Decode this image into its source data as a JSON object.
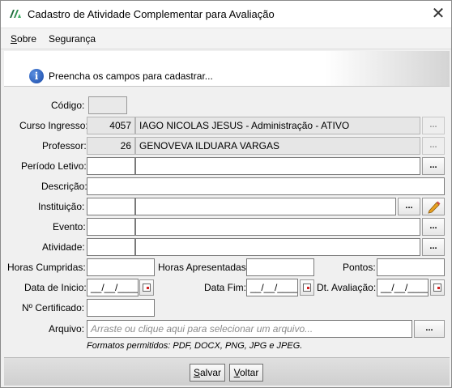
{
  "window": {
    "title": "Cadastro de Atividade Complementar para Avaliação",
    "close_glyph": "✕"
  },
  "menu": {
    "items": [
      {
        "label_first": "S",
        "label_rest": "obre"
      },
      {
        "label_first": "",
        "label_rest": "Segurança"
      }
    ]
  },
  "banner": {
    "icon": "info-icon",
    "text": "Preencha os campos para cadastrar..."
  },
  "form": {
    "codigo": {
      "label": "Código:",
      "value": ""
    },
    "curso": {
      "label": "Curso Ingresso:",
      "code": "4057",
      "description": "IAGO NICOLAS JESUS - Administração - ATIVO"
    },
    "professor": {
      "label": "Professor:",
      "code": "26",
      "description": "GENOVEVA ILDUARA VARGAS"
    },
    "periodo": {
      "label": "Período Letivo:",
      "code": "",
      "description": ""
    },
    "descricao": {
      "label": "Descrição:",
      "value": ""
    },
    "instituicao": {
      "label": "Instituição:",
      "code": "",
      "description": ""
    },
    "evento": {
      "label": "Evento:",
      "code": "",
      "description": ""
    },
    "atividade": {
      "label": "Atividade:",
      "code": "",
      "description": ""
    },
    "horas_cumpridas": {
      "label": "Horas Cumpridas:",
      "value": ""
    },
    "horas_apresentadas": {
      "label": "Horas Apresentadas:",
      "value": ""
    },
    "pontos": {
      "label": "Pontos:",
      "value": ""
    },
    "data_inicio": {
      "label": "Data de Inicio:",
      "value": "__/__/____"
    },
    "data_fim": {
      "label": "Data Fim:",
      "value": "__/__/____"
    },
    "dt_avaliacao": {
      "label": "Dt. Avaliação:",
      "value": "__/__/____"
    },
    "certificado": {
      "label": "Nº Certificado:",
      "value": ""
    },
    "arquivo": {
      "label": "Arquivo:",
      "placeholder": "Arraste ou clique aqui para selecionar um arquivo..."
    },
    "formatos": "Formatos permitidos: PDF, DOCX, PNG, JPG e JPEG.",
    "lookup_label": "..."
  },
  "footer": {
    "save_first": "S",
    "save_rest": "alvar",
    "back_first": "V",
    "back_rest": "oltar"
  }
}
